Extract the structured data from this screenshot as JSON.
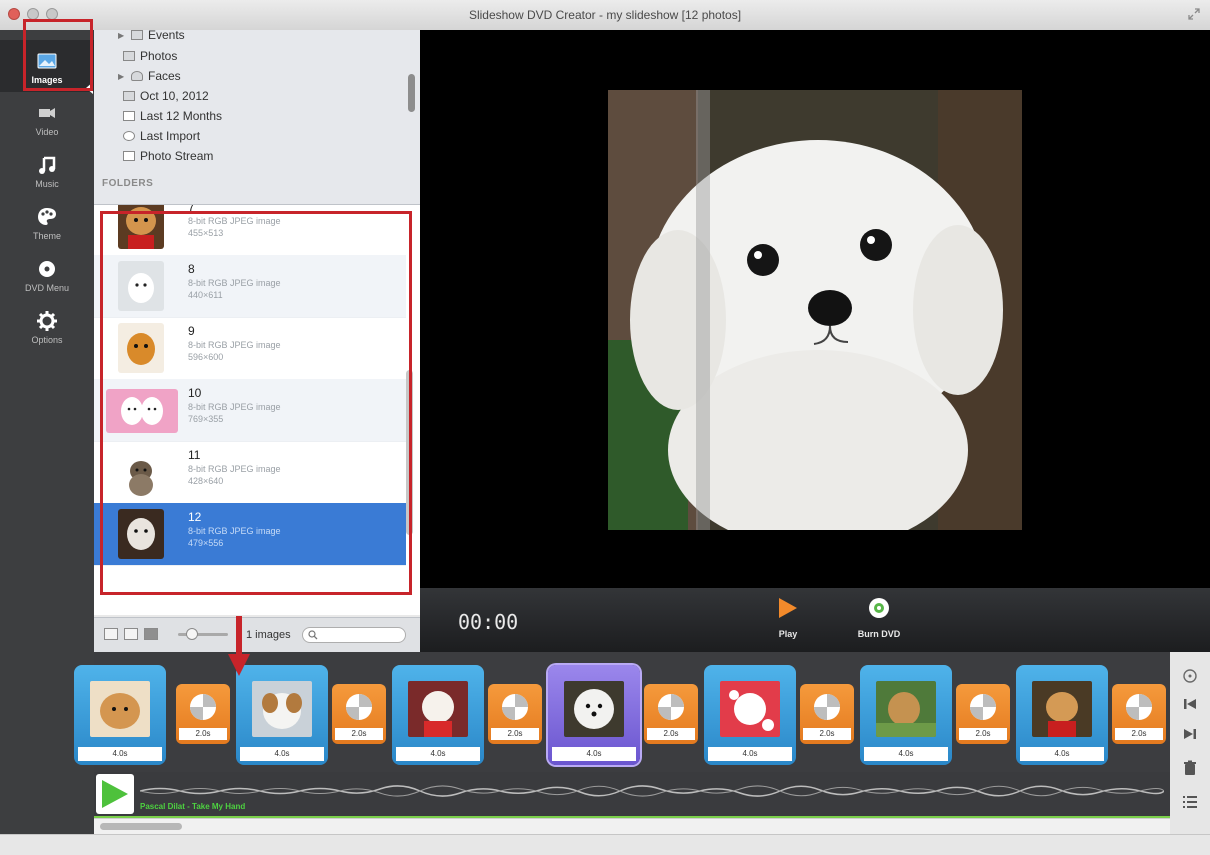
{
  "window": {
    "title": "Slideshow DVD Creator - my slideshow [12 photos]"
  },
  "nav": {
    "items": [
      {
        "label": "Images",
        "icon": "image-icon",
        "active": true
      },
      {
        "label": "Video",
        "icon": "video-camera-icon"
      },
      {
        "label": "Music",
        "icon": "music-note-icon"
      },
      {
        "label": "Theme",
        "icon": "palette-icon"
      },
      {
        "label": "DVD Menu",
        "icon": "disc-icon"
      },
      {
        "label": "Options",
        "icon": "gear-icon"
      }
    ]
  },
  "sources": {
    "items": [
      {
        "label": "Events",
        "expandable": true
      },
      {
        "label": "Photos"
      },
      {
        "label": "Faces",
        "expandable": true
      },
      {
        "label": "Oct 10, 2012"
      },
      {
        "label": "Last 12 Months"
      },
      {
        "label": "Last Import"
      },
      {
        "label": "Photo Stream"
      }
    ],
    "folders_label": "FOLDERS"
  },
  "image_list": {
    "rows": [
      {
        "num": "7",
        "kind": "8-bit RGB JPEG image",
        "dims": "455×513"
      },
      {
        "num": "8",
        "kind": "8-bit RGB JPEG image",
        "dims": "440×611"
      },
      {
        "num": "9",
        "kind": "8-bit RGB JPEG image",
        "dims": "596×600"
      },
      {
        "num": "10",
        "kind": "8-bit RGB JPEG image",
        "dims": "769×355"
      },
      {
        "num": "11",
        "kind": "8-bit RGB JPEG image",
        "dims": "428×640"
      },
      {
        "num": "12",
        "kind": "8-bit RGB JPEG image",
        "dims": "479×556",
        "selected": true
      }
    ]
  },
  "list_toolbar": {
    "count": "1 images"
  },
  "player": {
    "timecode": "00:00",
    "play_label": "Play",
    "burn_label": "Burn DVD"
  },
  "timeline": {
    "clips": [
      {
        "duration": "4.0s"
      },
      {
        "duration": "4.0s"
      },
      {
        "duration": "4.0s"
      },
      {
        "duration": "4.0s",
        "selected": true
      },
      {
        "duration": "4.0s"
      },
      {
        "duration": "4.0s"
      },
      {
        "duration": "4.0s"
      }
    ],
    "transitions": [
      {
        "duration": "2.0s"
      },
      {
        "duration": "2.0s"
      },
      {
        "duration": "2.0s"
      },
      {
        "duration": "2.0s"
      },
      {
        "duration": "2.0s"
      },
      {
        "duration": "2.0s"
      },
      {
        "duration": "2.0s"
      }
    ]
  },
  "music": {
    "track_title": "Pascal Dilat - Take My Hand"
  },
  "colors": {
    "accent": "#3a7bd5",
    "highlight": "#c7242a",
    "clip_blue": "#3fa3dd",
    "clip_selected": "#7d68d9",
    "transition_orange": "#f08a2c"
  }
}
